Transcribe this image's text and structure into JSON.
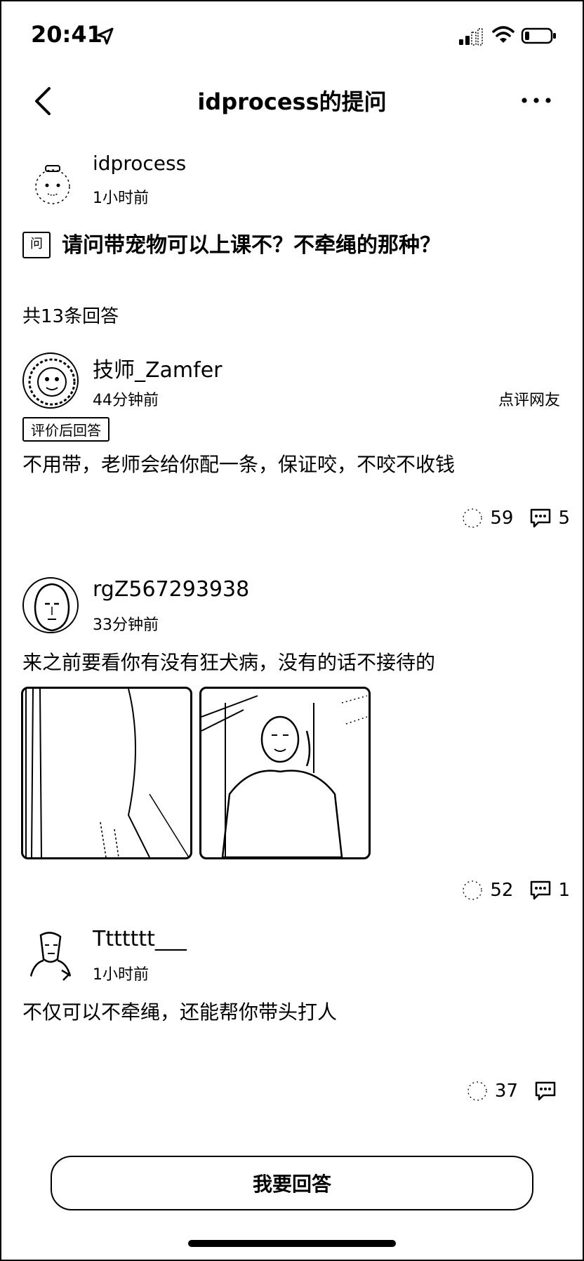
{
  "status_bar": {
    "time": "20:41"
  },
  "nav": {
    "title": "idprocess的提问"
  },
  "question": {
    "author": "idprocess",
    "time": "1小时前",
    "icon_label": "问",
    "text": "请问带宠物可以上课不？不牵绳的那种？"
  },
  "answer_count": "共13条回答",
  "answers": [
    {
      "author": "技师_Zamfer",
      "time": "44分钟前",
      "source": "点评网友",
      "tag": "评价后回答",
      "content": "不用带，老师会给你配一条，保证咬，不咬不收钱",
      "likes": "59",
      "comments": "5"
    },
    {
      "author": "rgZ567293938",
      "time": "33分钟前",
      "content": "来之前要看你有没有狂犬病，没有的话不接待的",
      "likes": "52",
      "comments": "1"
    },
    {
      "author": "Ttttttt___",
      "time": "1小时前",
      "content": "不仅可以不牵绳，还能帮你带头打人",
      "likes": "37",
      "comments": ""
    }
  ],
  "bottom": {
    "answer_button": "我要回答"
  }
}
